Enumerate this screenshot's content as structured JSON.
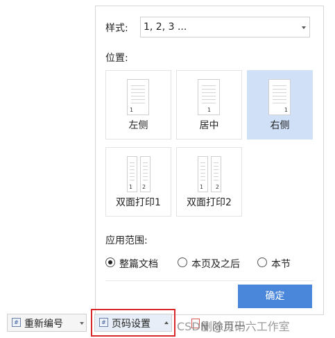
{
  "panel": {
    "style_label": "样式:",
    "style_value": "1, 2, 3 ...",
    "position_label": "位置:",
    "positions": [
      {
        "label": "左侧",
        "page_numbers": [
          "1"
        ],
        "selected": false
      },
      {
        "label": "居中",
        "page_numbers": [
          "1"
        ],
        "selected": false
      },
      {
        "label": "右侧",
        "page_numbers": [
          "1"
        ],
        "selected": true
      },
      {
        "label": "双面打印1",
        "page_numbers": [
          "1",
          "2"
        ],
        "selected": false
      },
      {
        "label": "双面打印2",
        "page_numbers": [
          "1",
          "2"
        ],
        "selected": false
      }
    ],
    "scope_label": "应用范围:",
    "scope_options": [
      {
        "label": "整篇文档",
        "checked": true
      },
      {
        "label": "本页及之后",
        "checked": false
      },
      {
        "label": "本节",
        "checked": false
      }
    ],
    "ok_label": "确定",
    "accent_color": "#4a86d9",
    "selected_tile_color": "#cfe0f7"
  },
  "toolbar": {
    "renumber_label": "重新编号",
    "page_setup_label": "页码设置",
    "delete_label": "删除页码",
    "highlight_color": "#d9262b"
  },
  "watermark": "CSDN @月十六工作室"
}
